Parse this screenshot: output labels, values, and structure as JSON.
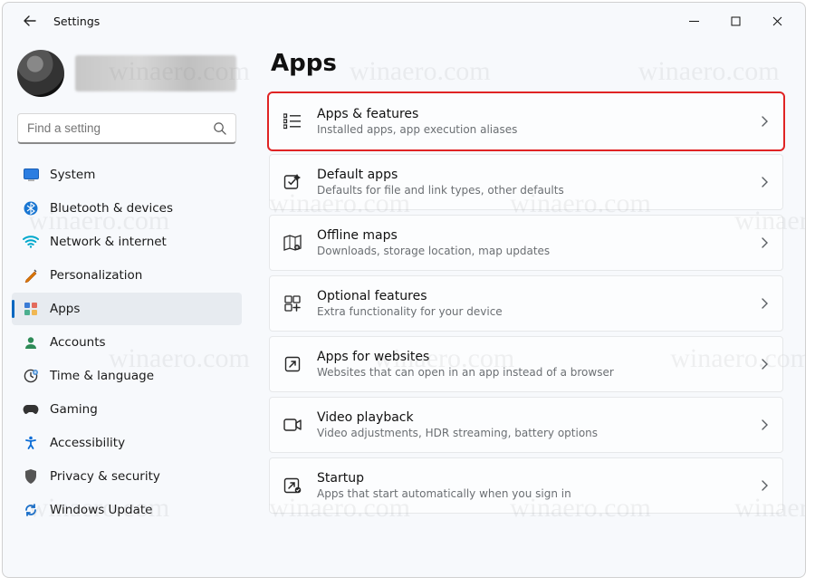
{
  "window": {
    "title": "Settings"
  },
  "search": {
    "placeholder": "Find a setting"
  },
  "sidebar": {
    "items": [
      {
        "id": "system",
        "label": "System"
      },
      {
        "id": "bluetooth",
        "label": "Bluetooth & devices"
      },
      {
        "id": "network",
        "label": "Network & internet"
      },
      {
        "id": "personal",
        "label": "Personalization"
      },
      {
        "id": "apps",
        "label": "Apps",
        "selected": true
      },
      {
        "id": "accounts",
        "label": "Accounts"
      },
      {
        "id": "time",
        "label": "Time & language"
      },
      {
        "id": "gaming",
        "label": "Gaming"
      },
      {
        "id": "access",
        "label": "Accessibility"
      },
      {
        "id": "privacy",
        "label": "Privacy & security"
      },
      {
        "id": "update",
        "label": "Windows Update"
      }
    ]
  },
  "page": {
    "heading": "Apps",
    "cards": [
      {
        "id": "apps-features",
        "title": "Apps & features",
        "sub": "Installed apps, app execution aliases",
        "highlight": true
      },
      {
        "id": "default-apps",
        "title": "Default apps",
        "sub": "Defaults for file and link types, other defaults"
      },
      {
        "id": "offline-maps",
        "title": "Offline maps",
        "sub": "Downloads, storage location, map updates"
      },
      {
        "id": "optional-features",
        "title": "Optional features",
        "sub": "Extra functionality for your device"
      },
      {
        "id": "apps-websites",
        "title": "Apps for websites",
        "sub": "Websites that can open in an app instead of a browser"
      },
      {
        "id": "video-playback",
        "title": "Video playback",
        "sub": "Video adjustments, HDR streaming, battery options"
      },
      {
        "id": "startup",
        "title": "Startup",
        "sub": "Apps that start automatically when you sign in"
      }
    ]
  },
  "watermark": "winaero.com"
}
